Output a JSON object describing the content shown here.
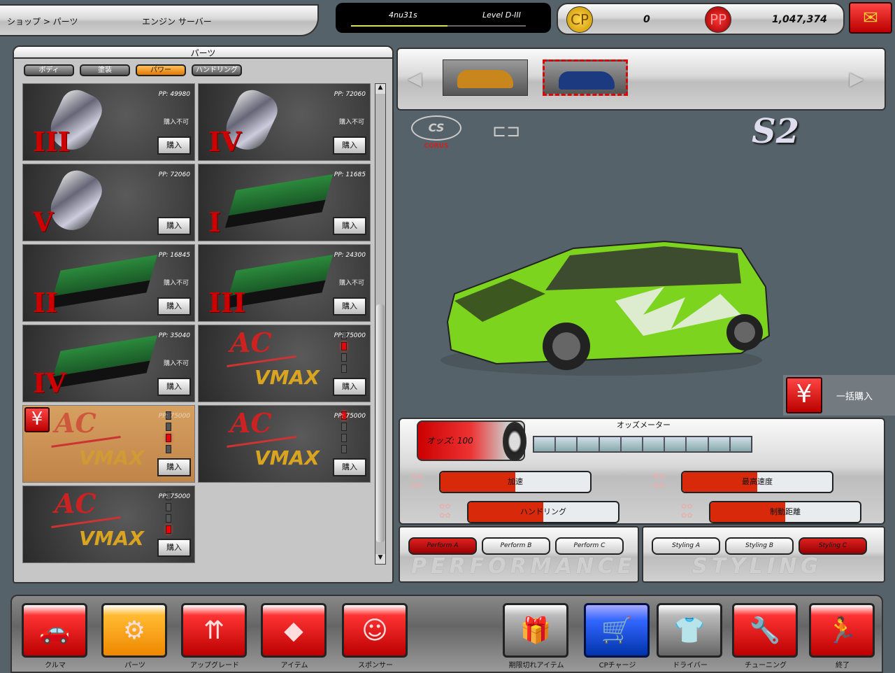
{
  "header": {
    "breadcrumb": "ショップ > パーツ",
    "section": "エンジン サーバー"
  },
  "player": {
    "name": "4nu31s",
    "level": "Level D-III",
    "xp_progress": 0.55
  },
  "currency": {
    "cp_label": "CP",
    "cp_value": "0",
    "pp_label": "PP",
    "pp_value": "1,047,374"
  },
  "mail": {
    "icon": "mail-icon"
  },
  "parts_panel": {
    "title": "パーツ",
    "tabs": [
      {
        "label": "ボディ",
        "active": false
      },
      {
        "label": "塗装",
        "active": false
      },
      {
        "label": "パワー",
        "active": true
      },
      {
        "label": "ハンドリング",
        "active": false
      }
    ],
    "buy_label": "購入",
    "unavailable_label": "購入不可",
    "items": [
      {
        "type": "muffler",
        "grade": "III",
        "price": "PP: 49980",
        "unavailable": true,
        "level": null,
        "selected": false
      },
      {
        "type": "muffler",
        "grade": "IV",
        "price": "PP: 72060",
        "unavailable": true,
        "level": null,
        "selected": false
      },
      {
        "type": "muffler",
        "grade": "V",
        "price": "PP: 72060",
        "unavailable": false,
        "level": null,
        "selected": false
      },
      {
        "type": "ecu",
        "grade": "I",
        "price": "PP: 11685",
        "unavailable": false,
        "level": null,
        "selected": false
      },
      {
        "type": "ecu",
        "grade": "II",
        "price": "PP: 16845",
        "unavailable": true,
        "level": null,
        "selected": false
      },
      {
        "type": "ecu",
        "grade": "III",
        "price": "PP: 24300",
        "unavailable": true,
        "level": null,
        "selected": false
      },
      {
        "type": "ecu",
        "grade": "IV",
        "price": "PP: 35040",
        "unavailable": true,
        "level": null,
        "selected": false
      },
      {
        "type": "ac-vmax",
        "grade": "",
        "price": "PP: 75000",
        "unavailable": false,
        "level": 2,
        "selected": false
      },
      {
        "type": "ac-vmax",
        "grade": "",
        "price": "PP: 75000",
        "unavailable": false,
        "level": 3,
        "selected": true
      },
      {
        "type": "ac-vmax",
        "grade": "",
        "price": "PP: 75000",
        "unavailable": false,
        "level": 1,
        "selected": false
      },
      {
        "type": "ac-vmax",
        "grade": "",
        "price": "PP: 75000",
        "unavailable": false,
        "level": 4,
        "selected": false
      }
    ],
    "logo_text": {
      "ac": "AC",
      "vmax": "VMAX"
    }
  },
  "car_selector": {
    "cars": [
      {
        "color": "#c8861c",
        "selected": false
      },
      {
        "color": "#1c3a80",
        "selected": true
      }
    ]
  },
  "car": {
    "maker": "CORUS",
    "model": "S2",
    "body_color": "#7cd41e"
  },
  "bulk_buy": {
    "label": "一括購入"
  },
  "odds": {
    "title": "オッズメーター",
    "value_label": "オッズ: 100",
    "segments_total": 10,
    "segments_filled": 0,
    "stats": [
      {
        "label": "加速",
        "value": 0.5
      },
      {
        "label": "最高速度",
        "value": 0.5
      },
      {
        "label": "ハンドリング",
        "value": 0.5
      },
      {
        "label": "制動距離",
        "value": 0.5
      }
    ]
  },
  "presets": {
    "performance": {
      "title": "PERFORMANCE",
      "buttons": [
        {
          "label": "Perform A",
          "active": true
        },
        {
          "label": "Perform B",
          "active": false
        },
        {
          "label": "Perform C",
          "active": false
        }
      ]
    },
    "styling": {
      "title": "STYLING",
      "buttons": [
        {
          "label": "Styling A",
          "active": false
        },
        {
          "label": "Styling B",
          "active": false
        },
        {
          "label": "Styling C",
          "active": true
        }
      ]
    }
  },
  "bottom_nav": [
    {
      "label": "クルマ",
      "icon": "car-icon",
      "style": "red"
    },
    {
      "label": "パーツ",
      "icon": "screw-icon",
      "style": "orange"
    },
    {
      "label": "アップグレード",
      "icon": "arrows-up-icon",
      "style": "red"
    },
    {
      "label": "アイテム",
      "icon": "diamonds-icon",
      "style": "red"
    },
    {
      "label": "スポンサー",
      "icon": "girl-icon",
      "style": "red"
    },
    {
      "label": "期限切れアイテム",
      "icon": "gift-icon",
      "style": "gray"
    },
    {
      "label": "CPチャージ",
      "icon": "cart-icon",
      "style": "blue"
    },
    {
      "label": "ドライバー",
      "icon": "jacket-icon",
      "style": "gray"
    },
    {
      "label": "チューニング",
      "icon": "wrench-icon",
      "style": "red"
    },
    {
      "label": "終了",
      "icon": "exit-icon",
      "style": "red"
    }
  ]
}
